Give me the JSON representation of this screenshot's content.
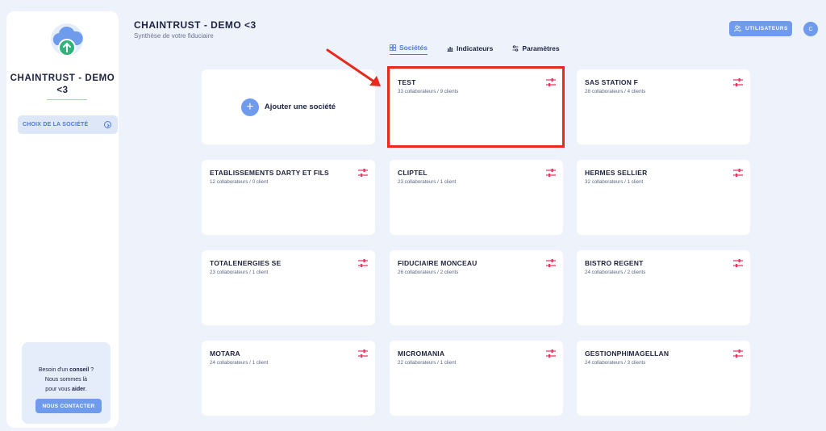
{
  "sidebar": {
    "title": "CHAINTRUST - DEMO <3",
    "choose_label": "CHOIX DE LA SOCIÉTÉ",
    "help_line1": "Besoin d'un",
    "help_line1_bold": "conseil",
    "help_line1_end": " ?",
    "help_line2": "Nous sommes là",
    "help_line3": "pour vous",
    "help_line3_bold": "aider",
    "help_line3_end": ".",
    "contact_label": "NOUS CONTACTER"
  },
  "header": {
    "title": "CHAINTRUST - DEMO <3",
    "subtitle": "Synthèse de votre fiduciaire",
    "users_label": "UTILISATEURS",
    "avatar_initial": "C"
  },
  "tabs": [
    {
      "label": "Sociétés",
      "icon": "grid-icon",
      "active": true
    },
    {
      "label": "Indicateurs",
      "icon": "chart-icon",
      "active": false
    },
    {
      "label": "Paramètres",
      "icon": "sliders-icon",
      "active": false
    }
  ],
  "add_card": {
    "label": "Ajouter une société"
  },
  "companies": [
    {
      "name": "TEST",
      "meta": "33 collaborateurs / 9 clients"
    },
    {
      "name": "SAS STATION F",
      "meta": "28 collaborateurs / 4 clients"
    },
    {
      "name": "ETABLISSEMENTS DARTY ET FILS",
      "meta": "12 collaborateurs / 0 client"
    },
    {
      "name": "CLIPTEL",
      "meta": "23 collaborateurs / 1 client"
    },
    {
      "name": "HERMES SELLIER",
      "meta": "32 collaborateurs / 1 client"
    },
    {
      "name": "TOTALENERGIES SE",
      "meta": "23 collaborateurs / 1 client"
    },
    {
      "name": "FIDUCIAIRE MONCEAU",
      "meta": "26 collaborateurs / 2 clients"
    },
    {
      "name": "BISTRO REGENT",
      "meta": "24 collaborateurs / 2 clients"
    },
    {
      "name": "MOTARA",
      "meta": "24 collaborateurs / 1 client"
    },
    {
      "name": "MICROMANIA",
      "meta": "22 collaborateurs / 1 client"
    },
    {
      "name": "GESTIONPHIMAGELLAN",
      "meta": "24 collaborateurs / 3 clients"
    }
  ],
  "colors": {
    "accent": "#6f9bec",
    "settings_icon": "#e8345f",
    "highlight": "#e8291c"
  }
}
